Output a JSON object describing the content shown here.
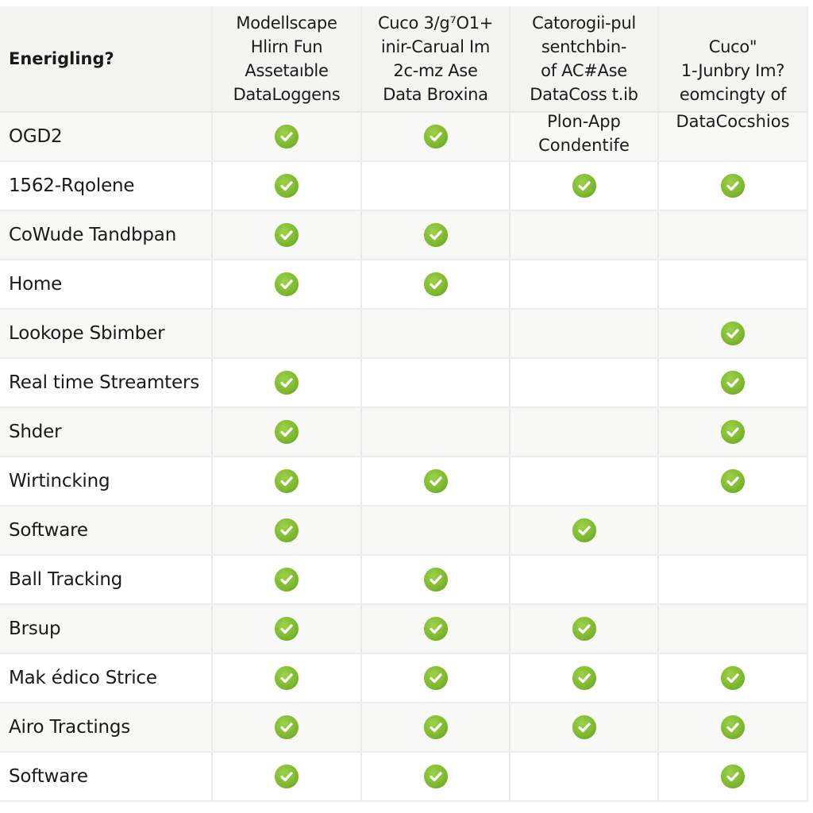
{
  "colors": {
    "check_green": "#7cb82f",
    "header_bg": "#f4f4f3",
    "row_alt_bg": "#f8f8f6",
    "grid_line": "#e9ebec"
  },
  "header": {
    "first_column": "Enerigling?",
    "columns": [
      "Modellscape\nHlirn Fun\nAssetaıble\nDataLoggens",
      "Cuco 3/g⁷O1+\ninir-Carual Im\n2c-mz Ase\nData Broxina",
      "Catorogii-pul\nsentchbin-\nof AC#Ase\nDataCoss t.ib",
      "Cuco\"\n1-Junbry Im?\neomcingty of"
    ]
  },
  "header_overflow": {
    "col3": "Plon-App\nCondentife",
    "col4": "DataCocshios"
  },
  "rows": [
    {
      "label": "OGD2",
      "checks": [
        true,
        true,
        false,
        false
      ]
    },
    {
      "label": "1562-Rqolene",
      "checks": [
        true,
        false,
        true,
        true
      ]
    },
    {
      "label": "CoWude Tandbpan",
      "checks": [
        true,
        true,
        false,
        false
      ]
    },
    {
      "label": "Home",
      "checks": [
        true,
        true,
        false,
        false
      ]
    },
    {
      "label": "Lookope Sbimber",
      "checks": [
        false,
        false,
        false,
        true
      ]
    },
    {
      "label": "Real time Streamters",
      "checks": [
        true,
        false,
        false,
        true
      ]
    },
    {
      "label": "Shder",
      "checks": [
        true,
        false,
        false,
        true
      ]
    },
    {
      "label": "Wirtincking",
      "checks": [
        true,
        true,
        false,
        true
      ]
    },
    {
      "label": "Software",
      "checks": [
        true,
        false,
        true,
        false
      ]
    },
    {
      "label": "Ball Tracking",
      "checks": [
        true,
        true,
        false,
        false
      ]
    },
    {
      "label": "Brsup",
      "checks": [
        true,
        true,
        true,
        false
      ]
    },
    {
      "label": "Mak édico Strice",
      "checks": [
        true,
        true,
        true,
        true
      ]
    },
    {
      "label": "Airo Tractings",
      "checks": [
        true,
        true,
        true,
        true
      ]
    },
    {
      "label": "Software",
      "checks": [
        true,
        true,
        false,
        true
      ]
    }
  ],
  "icons": {
    "check": "check-circle-icon"
  }
}
